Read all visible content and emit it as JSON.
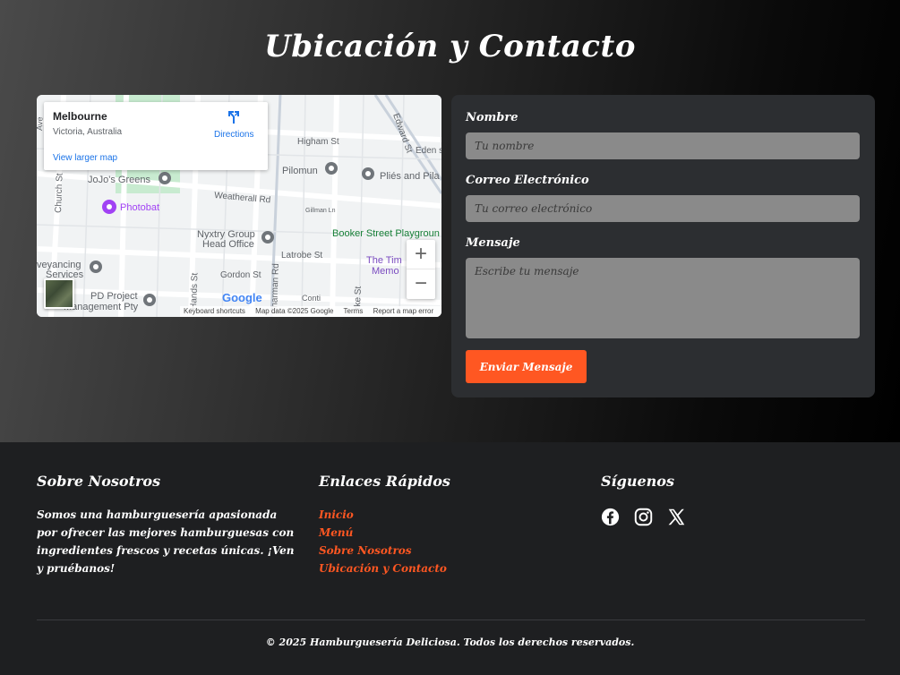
{
  "contact": {
    "title": "Ubicación y Contacto"
  },
  "map": {
    "place_name": "Melbourne",
    "place_region": "Victoria, Australia",
    "directions_label": "Directions",
    "larger_map_label": "View larger map",
    "zoom_in": "+",
    "zoom_out": "−",
    "google_label": "Google",
    "footer": {
      "shortcuts": "Keyboard shortcuts",
      "data": "Map data ©2025 Google",
      "terms": "Terms",
      "report": "Report a map error"
    },
    "labels": {
      "jojos": "JoJo's Greens",
      "photobat": "Photobat",
      "pilomun": "Pilomun",
      "plies": "Pliés and Pila",
      "weatherall": "Weatherall Rd",
      "higham": "Higham St",
      "edward": "Edward St",
      "eden": "Eden s",
      "nyxtry1": "Nyxtry Group",
      "nyxtry2": "Head Office",
      "latrobe": "Latrobe St",
      "booker": "Booker Street Playgroun",
      "conveyancing1": "veyancing",
      "conveyancing2": "Services",
      "gordon": "Gordon St",
      "pd1": "PD Project",
      "pd2": "Management Pty",
      "timber1": "The Tim",
      "timber2": "Memo",
      "church": "Church St",
      "charman": "Charman Rd",
      "gillman": "Gillman Ln",
      "hands": "Hands St",
      "parke": "rke St",
      "conti": "Conti",
      "ave": "Ave"
    }
  },
  "form": {
    "name_label": "Nombre",
    "name_placeholder": "Tu nombre",
    "email_label": "Correo Electrónico",
    "email_placeholder": "Tu correo electrónico",
    "message_label": "Mensaje",
    "message_placeholder": "Escribe tu mensaje",
    "submit_label": "Enviar Mensaje"
  },
  "footer": {
    "about_title": "Sobre Nosotros",
    "about_text": "Somos una hamburguesería apasionada por ofrecer las mejores hamburguesas con ingredientes frescos y recetas únicas. ¡Ven y pruébanos!",
    "links_title": "Enlaces Rápidos",
    "links": [
      "Inicio",
      "Menú",
      "Sobre Nosotros",
      "Ubicación y Contacto"
    ],
    "social_title": "Síguenos",
    "social_icons": [
      "facebook-icon",
      "instagram-icon",
      "x-icon"
    ],
    "copyright": "© 2025 Hamburguesería Deliciosa. Todos los derechos reservados."
  },
  "colors": {
    "accent": "#ff5722",
    "panel": "#2c2e31",
    "footer_bg": "#1e1f21",
    "input_bg": "#8a8a8a"
  }
}
